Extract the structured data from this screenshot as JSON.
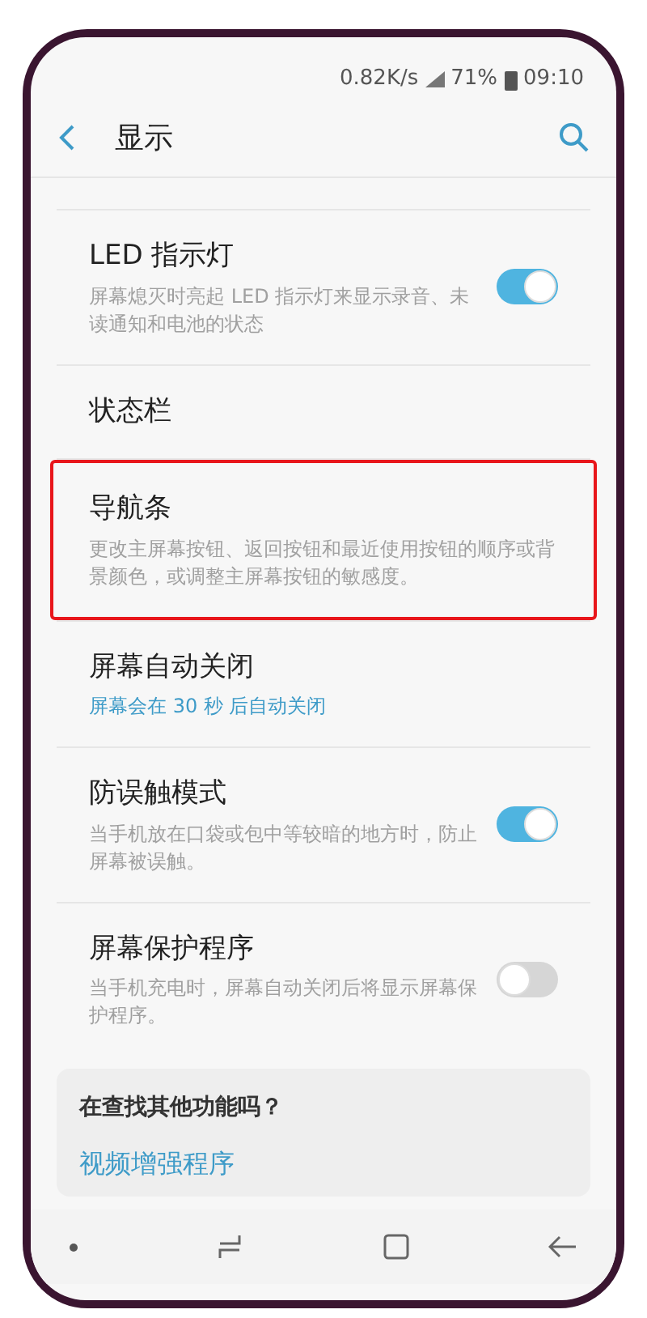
{
  "status_bar": {
    "speed": "0.82K/s",
    "battery": "71%",
    "time": "09:10"
  },
  "header": {
    "title": "显示"
  },
  "items": [
    {
      "kind": "toggle",
      "title": "LED 指示灯",
      "subtitle": "屏幕熄灭时亮起 LED 指示灯来显示录音、未读通知和电池的状态",
      "on": true,
      "highlighted": false
    },
    {
      "kind": "plain",
      "title": "状态栏",
      "highlighted": false
    },
    {
      "kind": "plain",
      "title": "导航条",
      "subtitle": "更改主屏幕按钮、返回按钮和最近使用按钮的顺序或背景颜色，或调整主屏幕按钮的敏感度。",
      "highlighted": true
    },
    {
      "kind": "value",
      "title": "屏幕自动关闭",
      "subtitle": "屏幕会在 30 秒 后自动关闭",
      "highlighted": false
    },
    {
      "kind": "toggle",
      "title": "防误触模式",
      "subtitle": "当手机放在口袋或包中等较暗的地方时，防止屏幕被误触。",
      "on": true,
      "highlighted": false
    },
    {
      "kind": "toggle",
      "title": "屏幕保护程序",
      "subtitle": "当手机充电时，屏幕自动关闭后将显示屏幕保护程序。",
      "on": false,
      "highlighted": false
    }
  ],
  "suggestions": {
    "title": "在查找其他功能吗？",
    "links": [
      "视频增强程序"
    ]
  }
}
